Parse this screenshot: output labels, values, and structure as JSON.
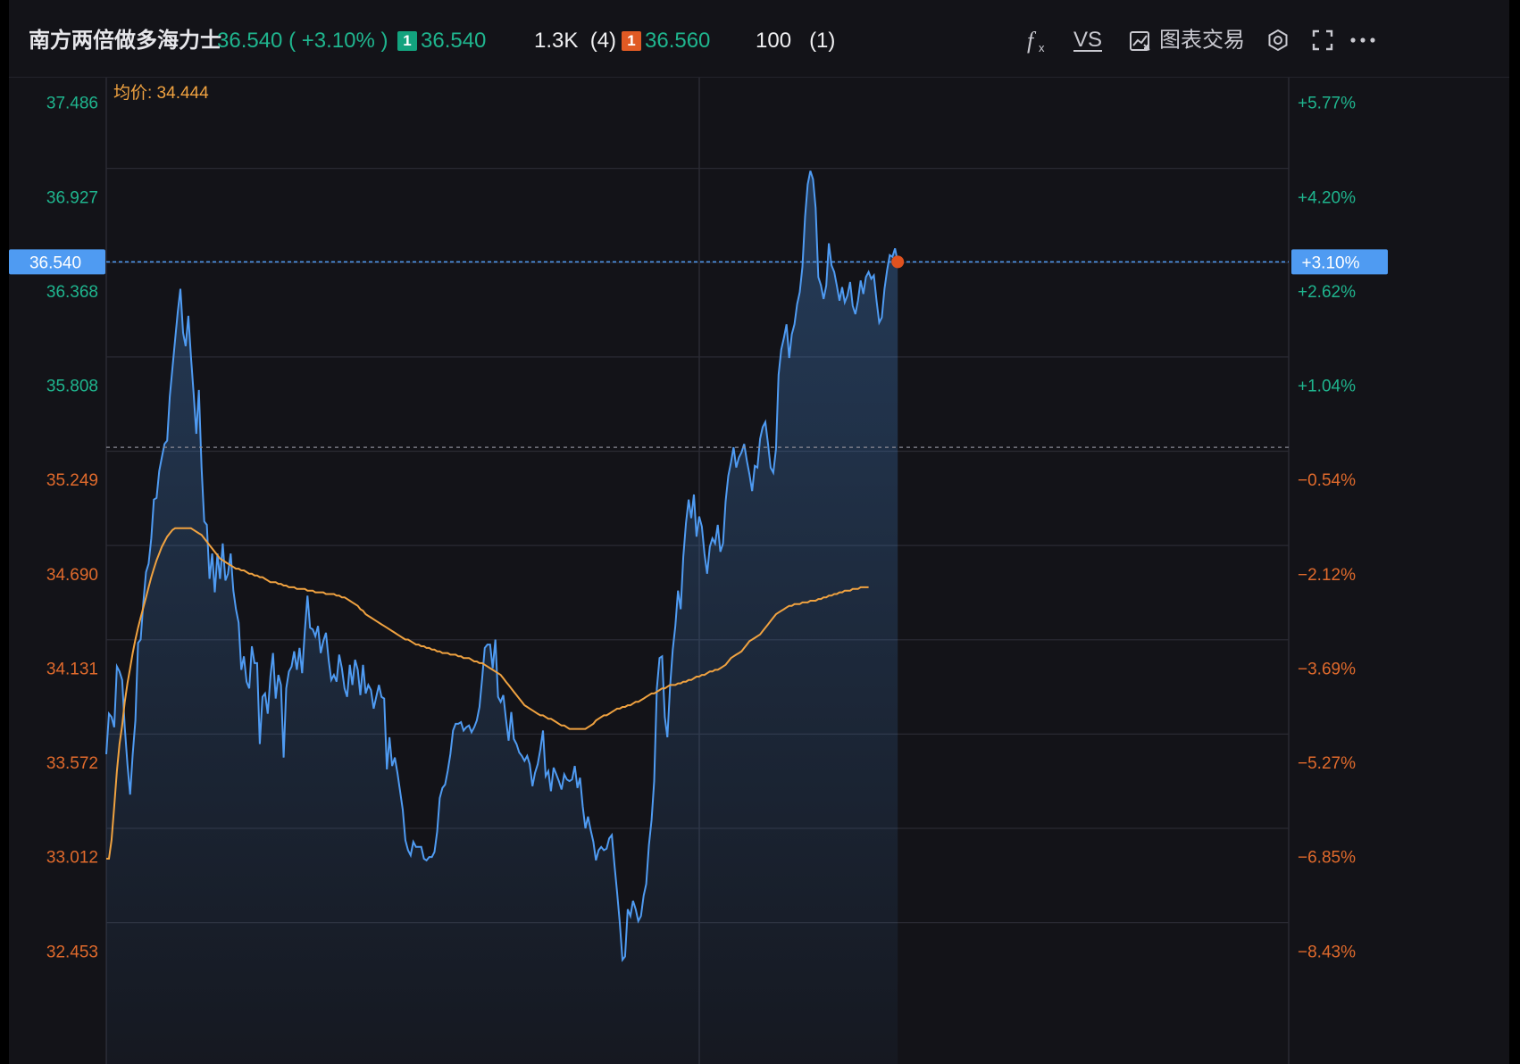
{
  "header": {
    "title": "南方两倍做多海力士",
    "last_price_change": "36.540 ( +3.10% )",
    "bid_level": "1",
    "bid_price": "36.540",
    "bid_volume": "1.3K",
    "bid_orders": "(4)",
    "ask_level": "1",
    "ask_price": "36.560",
    "ask_volume": "100",
    "ask_orders": "(1)"
  },
  "toolbar": {
    "indicator_icon": "fx-icon",
    "compare_label": "VS",
    "chart_trade_label": "图表交易",
    "chart_trade_icon": "chart-trade-icon",
    "settings_icon": "gear-icon",
    "fullscreen_icon": "fullscreen-icon",
    "more_icon": "more-icon"
  },
  "colors": {
    "background": "#131318",
    "price_line": "#4f9bf2",
    "avg_line": "#f0a240",
    "up": "#1fb58e",
    "down": "#e06a2c",
    "crosshair_label": "#4f9bf2"
  },
  "chart_data": {
    "type": "line",
    "avg_label": "均价: 34.444",
    "current_price_label": "36.540",
    "current_change_label": "+3.10%",
    "prev_close": 35.44,
    "ylim": [
      32.453,
      37.486
    ],
    "y_ticks": [
      "37.486",
      "36.927",
      "36.368",
      "35.808",
      "35.249",
      "34.690",
      "34.131",
      "33.572",
      "33.012",
      "32.453"
    ],
    "y_ticks_pct": [
      "+5.77%",
      "+4.20%",
      "+2.62%",
      "+1.04%",
      "−0.54%",
      "−2.12%",
      "−3.69%",
      "−5.27%",
      "−6.85%",
      "−8.43%"
    ],
    "price_series": [
      33.62,
      33.86,
      33.84,
      33.78,
      34.14,
      34.11,
      34.06,
      33.78,
      33.56,
      33.38,
      33.62,
      33.82,
      34.28,
      34.3,
      34.52,
      34.7,
      34.75,
      34.9,
      35.13,
      35.14,
      35.3,
      35.38,
      35.46,
      35.48,
      35.74,
      35.91,
      36.08,
      36.24,
      36.38,
      36.12,
      36.04,
      36.22,
      35.98,
      35.76,
      35.52,
      35.78,
      35.32,
      35.0,
      34.98,
      34.66,
      34.81,
      34.58,
      34.81,
      34.66,
      34.87,
      34.65,
      34.69,
      34.81,
      34.59,
      34.48,
      34.4,
      34.12,
      34.2,
      34.05,
      34.01,
      34.26,
      34.16,
      34.16,
      33.68,
      33.96,
      33.98,
      33.86,
      34.08,
      34.22,
      33.95,
      34.09,
      34.03,
      33.6,
      34.01,
      34.11,
      34.14,
      34.23,
      34.12,
      34.25,
      34.1,
      34.35,
      34.56,
      34.37,
      34.36,
      34.32,
      34.38,
      34.22,
      34.29,
      34.34,
      34.18,
      34.06,
      34.09,
      34.05,
      34.21,
      34.13,
      34.01,
      33.96,
      34.15,
      34.03,
      34.18,
      34.12,
      33.97,
      34.15,
      33.98,
      34.03,
      34.0,
      33.89,
      33.96,
      34.03,
      33.96,
      33.95,
      33.53,
      33.72,
      33.55,
      33.6,
      33.51,
      33.4,
      33.29,
      33.11,
      33.05,
      33.02,
      33.1,
      33.07,
      33.07,
      33.07,
      33.0,
      32.99,
      33.01,
      33.01,
      33.04,
      33.16,
      33.36,
      33.42,
      33.44,
      33.52,
      33.62,
      33.76,
      33.8,
      33.8,
      33.81,
      33.76,
      33.78,
      33.79,
      33.75,
      33.78,
      33.82,
      33.9,
      34.07,
      34.25,
      34.27,
      34.27,
      34.13,
      34.3,
      33.96,
      33.93,
      33.97,
      33.83,
      33.7,
      33.87,
      33.71,
      33.68,
      33.63,
      33.61,
      33.58,
      33.61,
      33.56,
      33.43,
      33.51,
      33.56,
      33.65,
      33.76,
      33.49,
      33.52,
      33.4,
      33.54,
      33.5,
      33.46,
      33.41,
      33.5,
      33.47,
      33.46,
      33.47,
      33.55,
      33.42,
      33.48,
      33.31,
      33.18,
      33.25,
      33.17,
      33.1,
      32.99,
      33.05,
      33.07,
      33.05,
      33.06,
      33.12,
      33.14,
      32.96,
      32.8,
      32.62,
      32.4,
      32.42,
      32.7,
      32.66,
      32.75,
      32.7,
      32.63,
      32.66,
      32.78,
      32.85,
      33.08,
      33.23,
      33.46,
      34.01,
      34.19,
      34.2,
      33.84,
      33.72,
      34.02,
      34.24,
      34.38,
      34.59,
      34.48,
      34.79,
      34.99,
      35.13,
      35.02,
      35.16,
      34.91,
      35.03,
      34.97,
      34.81,
      34.69,
      34.85,
      34.9,
      34.87,
      34.98,
      34.82,
      34.87,
      35.12,
      35.27,
      35.35,
      35.44,
      35.32,
      35.38,
      35.41,
      35.46,
      35.36,
      35.28,
      35.18,
      35.33,
      35.32,
      35.49,
      35.56,
      35.59,
      35.46,
      35.32,
      35.29,
      35.43,
      35.87,
      36.02,
      36.09,
      36.17,
      35.97,
      36.11,
      36.17,
      36.29,
      36.36,
      36.51,
      36.81,
      37.0,
      37.08,
      37.03,
      36.86,
      36.45,
      36.4,
      36.32,
      36.4,
      36.65,
      36.52,
      36.48,
      36.4,
      36.31,
      36.39,
      36.3,
      36.34,
      36.42,
      36.28,
      36.23,
      36.31,
      36.43,
      36.35,
      36.45,
      36.48,
      36.44,
      36.46,
      36.31,
      36.18,
      36.21,
      36.38,
      36.49,
      36.58,
      36.57,
      36.62,
      36.54
    ],
    "avg_series": [
      33.0,
      33.0,
      33.11,
      33.31,
      33.52,
      33.68,
      33.79,
      33.93,
      34.04,
      34.13,
      34.22,
      34.3,
      34.37,
      34.43,
      34.49,
      34.55,
      34.61,
      34.67,
      34.72,
      34.77,
      34.81,
      34.85,
      34.88,
      34.91,
      34.93,
      34.95,
      34.96,
      34.96,
      34.96,
      34.96,
      34.96,
      34.96,
      34.96,
      34.95,
      34.94,
      34.93,
      34.92,
      34.9,
      34.88,
      34.86,
      34.84,
      34.82,
      34.8,
      34.78,
      34.77,
      34.76,
      34.75,
      34.74,
      34.73,
      34.72,
      34.72,
      34.71,
      34.71,
      34.7,
      34.69,
      34.69,
      34.68,
      34.68,
      34.67,
      34.67,
      34.66,
      34.65,
      34.64,
      34.64,
      34.64,
      34.63,
      34.63,
      34.62,
      34.62,
      34.61,
      34.61,
      34.61,
      34.6,
      34.6,
      34.6,
      34.6,
      34.59,
      34.59,
      34.59,
      34.58,
      34.58,
      34.58,
      34.58,
      34.57,
      34.57,
      34.57,
      34.57,
      34.56,
      34.56,
      34.55,
      34.55,
      34.54,
      34.53,
      34.52,
      34.51,
      34.5,
      34.48,
      34.47,
      34.45,
      34.44,
      34.43,
      34.42,
      34.41,
      34.4,
      34.39,
      34.38,
      34.37,
      34.36,
      34.35,
      34.34,
      34.33,
      34.32,
      34.31,
      34.3,
      34.3,
      34.29,
      34.28,
      34.27,
      34.27,
      34.26,
      34.26,
      34.25,
      34.25,
      34.24,
      34.24,
      34.23,
      34.23,
      34.22,
      34.22,
      34.22,
      34.21,
      34.21,
      34.21,
      34.2,
      34.2,
      34.19,
      34.19,
      34.19,
      34.18,
      34.17,
      34.17,
      34.16,
      34.16,
      34.15,
      34.14,
      34.13,
      34.12,
      34.11,
      34.1,
      34.09,
      34.07,
      34.05,
      34.03,
      34.01,
      33.99,
      33.97,
      33.95,
      33.93,
      33.91,
      33.9,
      33.89,
      33.88,
      33.87,
      33.86,
      33.85,
      33.85,
      33.84,
      33.83,
      33.83,
      33.82,
      33.81,
      33.8,
      33.79,
      33.79,
      33.78,
      33.77,
      33.77,
      33.77,
      33.77,
      33.77,
      33.77,
      33.77,
      33.78,
      33.79,
      33.8,
      33.82,
      33.83,
      33.84,
      33.85,
      33.85,
      33.86,
      33.87,
      33.88,
      33.89,
      33.89,
      33.9,
      33.9,
      33.91,
      33.91,
      33.92,
      33.93,
      33.93,
      33.94,
      33.95,
      33.96,
      33.97,
      33.98,
      33.98,
      33.99,
      34.0,
      34.01,
      34.01,
      34.02,
      34.03,
      34.03,
      34.03,
      34.04,
      34.04,
      34.05,
      34.05,
      34.06,
      34.06,
      34.07,
      34.08,
      34.08,
      34.09,
      34.09,
      34.1,
      34.11,
      34.11,
      34.12,
      34.12,
      34.13,
      34.14,
      34.15,
      34.17,
      34.19,
      34.2,
      34.21,
      34.22,
      34.23,
      34.25,
      34.27,
      34.29,
      34.3,
      34.31,
      34.32,
      34.33,
      34.35,
      34.37,
      34.39,
      34.41,
      34.43,
      34.45,
      34.46,
      34.47,
      34.48,
      34.49,
      34.5,
      34.5,
      34.51,
      34.51,
      34.51,
      34.52,
      34.52,
      34.52,
      34.53,
      34.53,
      34.53,
      34.54,
      34.54,
      34.55,
      34.55,
      34.56,
      34.56,
      34.57,
      34.57,
      34.58,
      34.58,
      34.59,
      34.59,
      34.59,
      34.6,
      34.6,
      34.6,
      34.61,
      34.61,
      34.61,
      34.61
    ]
  }
}
